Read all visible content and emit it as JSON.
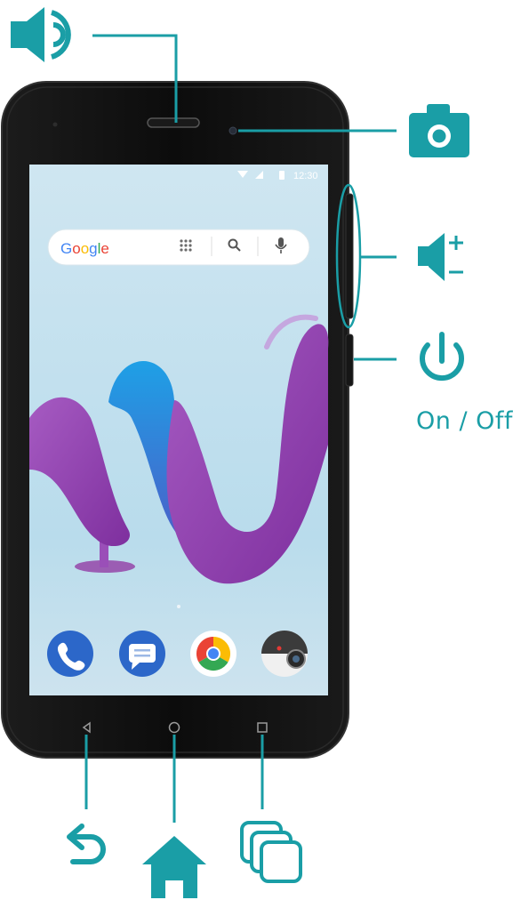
{
  "accent": "#1a9ea6",
  "status_bar": {
    "time": "12:30"
  },
  "search_bar": {
    "brand": [
      "G",
      "o",
      "o",
      "g",
      "l",
      "e"
    ],
    "brand_colors": [
      "#4285f4",
      "#ea4335",
      "#fbbc05",
      "#4285f4",
      "#34a853",
      "#ea4335"
    ]
  },
  "dock": {
    "apps": [
      "phone-icon",
      "messages-icon",
      "chrome-icon",
      "camera-app-icon"
    ]
  },
  "nav_bar": {
    "buttons": [
      "back",
      "home",
      "recents"
    ]
  },
  "callouts": {
    "power_label": "On / Off",
    "icons": [
      "speaker-icon",
      "camera-icon",
      "volume-icon",
      "power-icon",
      "back-arrow-icon",
      "home-icon",
      "recents-icon"
    ]
  }
}
